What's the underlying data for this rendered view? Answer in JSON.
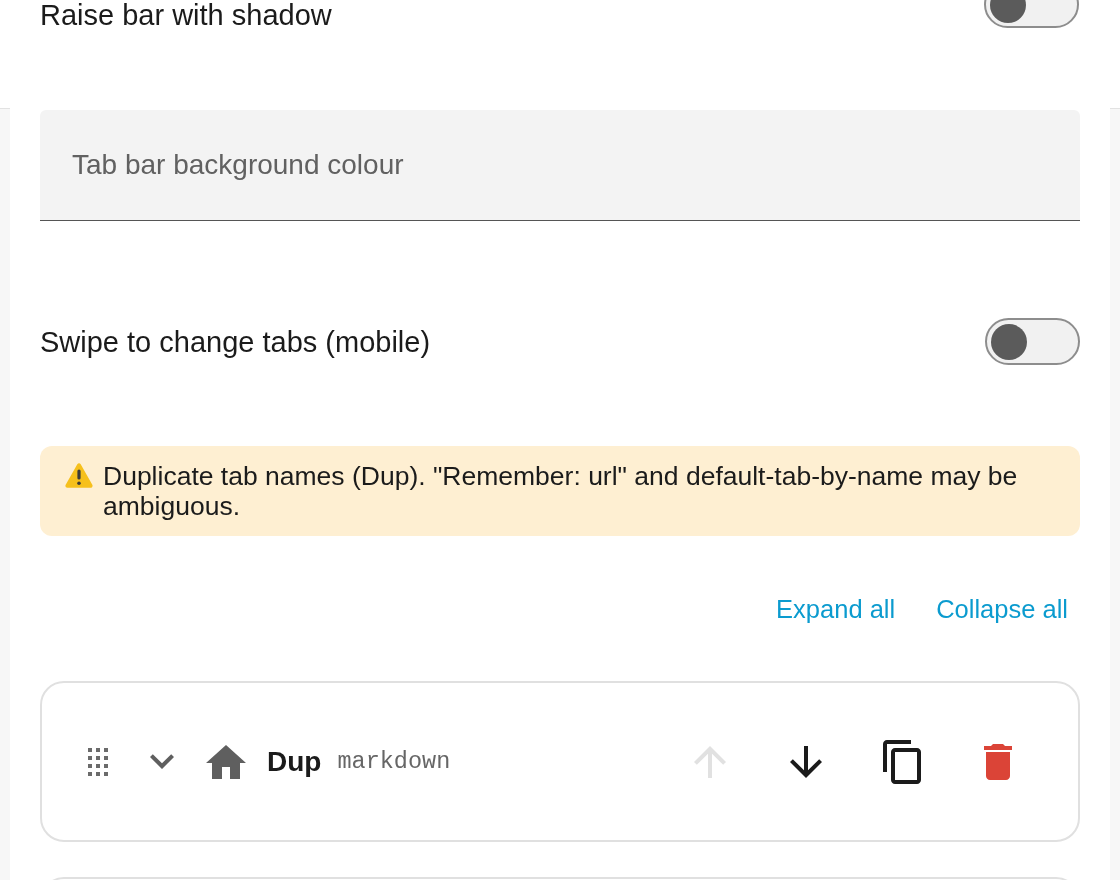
{
  "shadow_setting": {
    "label": "Raise bar with shadow",
    "on": false
  },
  "background_colour_field": {
    "placeholder": "Tab bar background colour"
  },
  "swipe_setting": {
    "label": "Swipe to change tabs (mobile)",
    "on": false
  },
  "warning": {
    "text": "Duplicate tab names (Dup). \"Remember: url\" and default-tab-by-name may be ambiguous."
  },
  "list_actions": [
    {
      "label": "Expand all"
    },
    {
      "label": "Collapse all"
    }
  ],
  "tabs": [
    {
      "name": "Dup",
      "type": "markdown",
      "expanded": false,
      "buttons": [
        {
          "kind": "move_up",
          "disabled": true
        },
        {
          "kind": "move_down",
          "disabled": false
        },
        {
          "kind": "duplicate",
          "disabled": false
        },
        {
          "kind": "delete",
          "disabled": false
        }
      ]
    }
  ],
  "next_tab_card_partly_visible": true
}
